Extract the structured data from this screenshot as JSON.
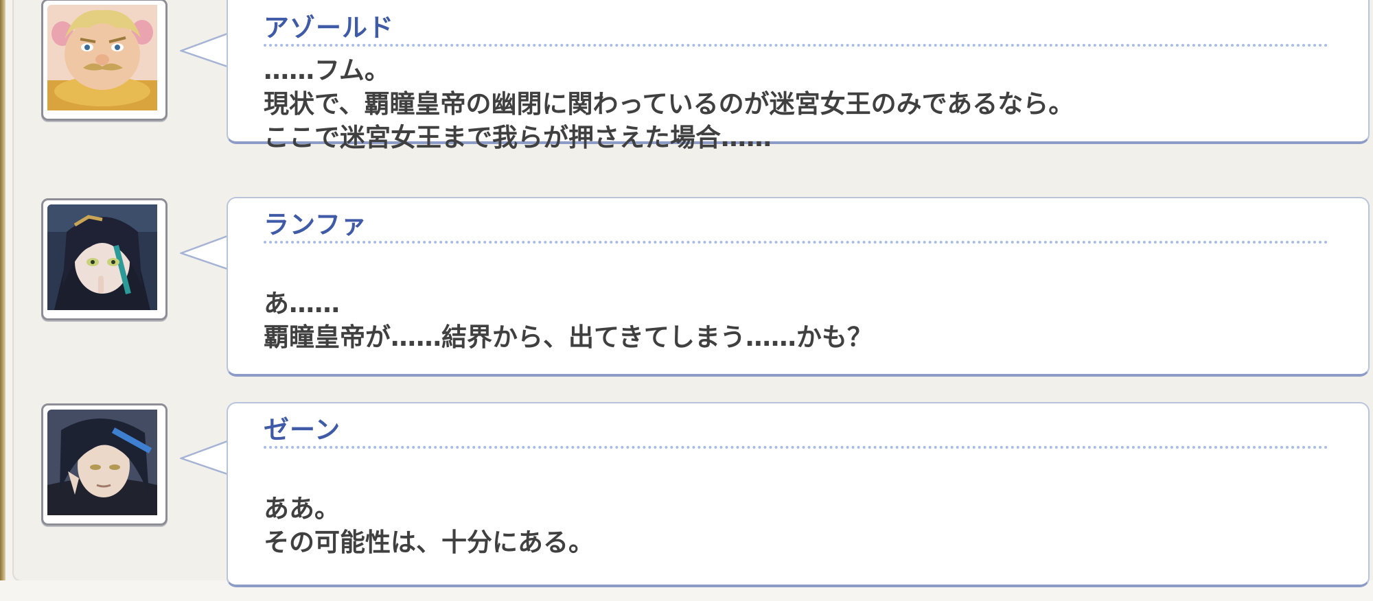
{
  "dialogue": [
    {
      "speaker": "アゾールド",
      "avatar_icon": "azold-portrait",
      "lines": [
        "……フム。",
        "現状で、覇瞳皇帝の幽閉に関わっているのが迷宮女王のみであるなら。",
        "ここで迷宮女王まで我らが押さえた場合……"
      ]
    },
    {
      "speaker": "ランファ",
      "avatar_icon": "ranfa-portrait",
      "lines": [
        "",
        "あ……",
        "覇瞳皇帝が……結界から、出てきてしまう……かも？"
      ]
    },
    {
      "speaker": "ゼーン",
      "avatar_icon": "zehn-portrait",
      "lines": [
        "",
        "ああ。",
        "その可能性は、十分にある。"
      ]
    }
  ],
  "colors": {
    "speaker_name": "#3f5aa6",
    "dialogue_text": "#404040",
    "bubble_border": "#8c9cc7",
    "divider": "#a8bde6",
    "background": "#f1f0eb"
  }
}
